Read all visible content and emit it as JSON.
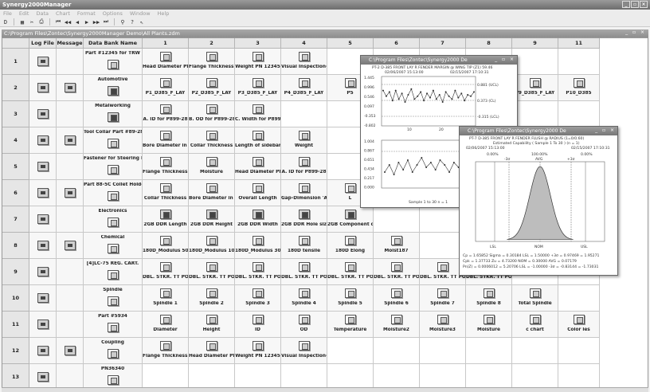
{
  "app": {
    "title": "Synergy2000Manager",
    "menu": [
      "File",
      "Edit",
      "Data",
      "Chart",
      "Format",
      "Options",
      "Window",
      "Help"
    ],
    "toolbar": [
      "save-icon",
      "folder-icon",
      "cut-icon",
      "print-icon",
      "first-icon",
      "prev-page-icon",
      "prev-icon",
      "next-icon",
      "next-page-icon",
      "last-icon",
      "binoculars-icon",
      "question-icon",
      "help-arrow-icon"
    ],
    "toolbar_glyphs": [
      "D",
      "▦",
      "✂",
      "⎙",
      "⏮",
      "◀◀",
      "◀",
      "▶",
      "▶▶",
      "⏭",
      "⚲",
      "?",
      "⇖"
    ],
    "doc_title": "C:\\Program Files\\Zontec\\Synergy2000Manager Demo\\All Plants.zdm",
    "window_controls": "_ ▫ ×"
  },
  "grid": {
    "headers": [
      "",
      "Log File",
      "Message",
      "Data Bank Name",
      "1",
      "2",
      "3",
      "4",
      "5",
      "6",
      "7",
      "8",
      "9",
      "11"
    ],
    "rows": [
      {
        "num": "1",
        "name": "Part #12345 for TRW",
        "log": true,
        "msg": false,
        "name_btn": "light",
        "cells": [
          "Head Diameter PN 1",
          "Flange Thickness PN",
          "Weight PN 12345",
          "Visual Inspection-Dr",
          "",
          "",
          "",
          "",
          "",
          ""
        ]
      },
      {
        "num": "2",
        "name": "Automotive",
        "log": true,
        "msg": true,
        "name_btn": "dark",
        "cells": [
          "P1_D385_F_LAY",
          "P2_D385_F_LAY",
          "P3_D385_F_LAY",
          "P4_D385_F_LAY",
          "P5",
          "",
          "",
          "P8_D385_F_LAY",
          "P9_D385_F_LAY",
          "P10_D385"
        ]
      },
      {
        "num": "3",
        "name": "Metalworking",
        "log": true,
        "msg": false,
        "name_btn": "dark",
        "cells": [
          "A. ID for P899-28",
          "B. OD for P899-28",
          "C. Width for P899-28",
          "",
          "",
          "",
          "",
          "",
          "",
          ""
        ]
      },
      {
        "num": "4",
        "name": "Tool Collar Part #89-28",
        "log": true,
        "msg": true,
        "name_btn": "light",
        "cells": [
          "Bore Diameter in mm",
          "Collar Thickness",
          "Length of sidebar",
          "Weight",
          "",
          "",
          "",
          "",
          "",
          ""
        ]
      },
      {
        "num": "5",
        "name": "Fastener for Steering Lin",
        "log": true,
        "msg": false,
        "name_btn": "light",
        "cells": [
          "Flange Thickness PN",
          "Moisture",
          "Head Diameter PN 1",
          "A. ID for P899-28",
          "",
          "",
          "",
          "",
          "",
          ""
        ]
      },
      {
        "num": "6",
        "name": "Part 88-5C Collet Holder",
        "log": true,
        "msg": true,
        "name_btn": "light",
        "cells": [
          "Collar Thickness",
          "Bore Diameter in mm",
          "Overall Length",
          "Gap-Dimension 'A'",
          "L",
          "",
          "",
          "",
          "",
          ""
        ]
      },
      {
        "num": "7",
        "name": "Electronics",
        "log": true,
        "msg": false,
        "name_btn": "light",
        "cells": [
          "2GB DDR Length",
          "2GB DDR Height",
          "2GB DDR Width",
          "2GB DDR Hole size",
          "2GB Component defe",
          "",
          "",
          "",
          "",
          ""
        ]
      },
      {
        "num": "8",
        "name": "Chemical",
        "log": true,
        "msg": true,
        "name_btn": "light",
        "cells": [
          "180D_Modulus 50%",
          "180D_Modulus 100%",
          "180D_Modulus 300%",
          "180D tensile",
          "180D Elong",
          "Moist187",
          "",
          "",
          "",
          ""
        ]
      },
      {
        "num": "9",
        "name": "[4]LC-75 REG. CART.",
        "log": true,
        "msg": false,
        "name_btn": "light",
        "cells": [
          "DBL. STKR. TT POC.",
          "DBL. STKR. TT POC.",
          "DBL. STKR. TT POC.",
          "DBL. STKR. TT POC.",
          "DBL. STKR. TT POC.",
          "DBL. STKR. TT POC.",
          "DBL. STKR. TT POC.",
          "DBL. STKR. TT POC.",
          "",
          ""
        ]
      },
      {
        "num": "10",
        "name": "Spindle",
        "log": true,
        "msg": false,
        "name_btn": "light",
        "cells": [
          "Spindle 1",
          "Spindle 2",
          "Spindle 3",
          "Spindle 4",
          "Spindle 5",
          "Spindle 6",
          "Spindle 7",
          "Spindle 8",
          "Total Spindle",
          ""
        ]
      },
      {
        "num": "11",
        "name": "Part #5934",
        "log": true,
        "msg": false,
        "name_btn": "light",
        "cells": [
          "Diameter",
          "Height",
          "ID",
          "OD",
          "Temperature",
          "Moisture2",
          "Moisture3",
          "Moisture",
          "c chart",
          "Color les"
        ]
      },
      {
        "num": "12",
        "name": "Coupling",
        "log": true,
        "msg": true,
        "name_btn": "light",
        "cells": [
          "Flange Thickness PN",
          "Head Diameter PN 1",
          "Weight PN 12345",
          "Visual Inspection-Dr",
          "",
          "",
          "",
          "",
          "",
          ""
        ]
      },
      {
        "num": "13",
        "name": "PN36340",
        "log": true,
        "msg": false,
        "name_btn": "light",
        "cells": [
          "",
          "",
          "",
          "",
          "",
          "",
          "",
          "",
          "",
          ""
        ]
      }
    ]
  },
  "popup1": {
    "title": "C:\\Program Files\\Zontec\\Synergy2000 De",
    "controls": "_ ▫ ×",
    "heading": "PT-2 D-385 FRONT LAY R FENDER MARGIN @ WING TIP (Z1) 59.46",
    "date_left": "02/06/2007 15:13:00",
    "date_right": "02/15/2007 17:10:31",
    "x_top": [
      "10",
      "20"
    ],
    "y_top": [
      "1.445",
      "0.996",
      "0.546",
      "0.097",
      "-0.353",
      "-0.802"
    ],
    "y_bottom": [
      "1.004",
      "0.867",
      "0.651",
      "0.434",
      "0.217",
      "0.000"
    ],
    "top_limits": [
      "0.881 (UCL)",
      "0.373 (CL)",
      "-0.315 (LCL)"
    ],
    "top_series": [
      0.9,
      0.7,
      0.85,
      0.55,
      0.9,
      0.6,
      0.8,
      0.5,
      0.75,
      0.95,
      0.6,
      0.7,
      0.85,
      0.55,
      0.8,
      0.65,
      0.9,
      0.6,
      0.75,
      0.5,
      0.85,
      0.7,
      0.6,
      0.9,
      0.65,
      0.8,
      0.55,
      0.75,
      0.7,
      0.85
    ],
    "bottom_series": [
      0.3,
      0.45,
      0.25,
      0.5,
      0.35,
      0.55,
      0.3,
      0.45,
      0.6,
      0.4,
      0.5,
      0.35,
      0.55,
      0.45,
      0.3,
      0.5,
      0.4,
      0.6,
      0.35,
      0.45
    ],
    "footer": "Sample 1 to 30 n = 1"
  },
  "popup2": {
    "title": "C:\\Program Files\\Zontec\\Synergy2000 De",
    "controls": "_ ▫ ×",
    "heading": "PT-7 D-385 FRONT LAY R FENDER FLUSH @ RADIUS (1=0/0.60)",
    "subheading": "Estimated Capability   ( Sample 1 To 30 )  (n = 1)",
    "date_left": "02/06/2007 15:13:00",
    "date_right": "02/15/2007 17:10:31",
    "pct_left": "0.00%",
    "pct_mid": "100.00%",
    "pct_right": "0.00%",
    "sigma_labels": [
      "-3σ",
      "AVG",
      "+3σ"
    ],
    "axis_labels": [
      "LSL",
      "NOM",
      "USL"
    ],
    "stats": [
      "Cp = 1.65852   Sigma = 0.30184   LSL = 1.50000   +3σ = 0.97469 = 1.95271",
      "Cpk = 1.37733   Zu = 4.73200   NOM = 0.30000   AVG = 0.07179",
      "Pn(Z) = 0.0006012 = 5.20706   LSL = -1.00000   -3σ = -0.83144 = -1.73031"
    ]
  }
}
